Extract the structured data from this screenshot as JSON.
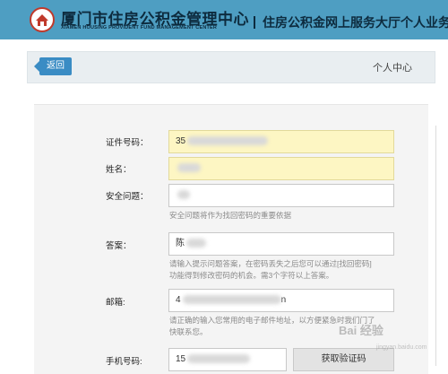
{
  "header": {
    "org_name_cn": "厦门市住房公积金管理中心",
    "org_name_en": "XIAMEN HOUSING PROVIDENT FUND MANAGEMENT CENTER",
    "service_title": "住房公积金网上服务大厅个人业务",
    "brand_color": "#4e9ec2"
  },
  "nav": {
    "back_label": "返回",
    "page_title": "个人中心"
  },
  "form": {
    "id_label": "证件号码：",
    "id_value": "35",
    "name_label": "姓名：",
    "name_value": "",
    "question_label": "安全问题：",
    "question_value": "",
    "question_hint": "安全问题将作为找回密码的重要依据",
    "answer_label": "答案：",
    "answer_value": "陈",
    "answer_hint_1": "请输入提示问题答案，在密码丢失之后您可以通过[找回密码]",
    "answer_hint_2": "功能得到修改密码的机会。需3个字符以上答案。",
    "email_label": "邮箱:",
    "email_value": "4",
    "email_value_suffix": "n",
    "email_hint_1": "请正确的输入您常用的电子邮件地址，以方便紧急时我们门了",
    "email_hint_2": "快联系您。",
    "phone_label": "手机号码:",
    "phone_value": "15",
    "sms_button": "获取验证码"
  },
  "watermark": {
    "text": "Bai 经验",
    "sub": "jingyan.baidu.com"
  }
}
